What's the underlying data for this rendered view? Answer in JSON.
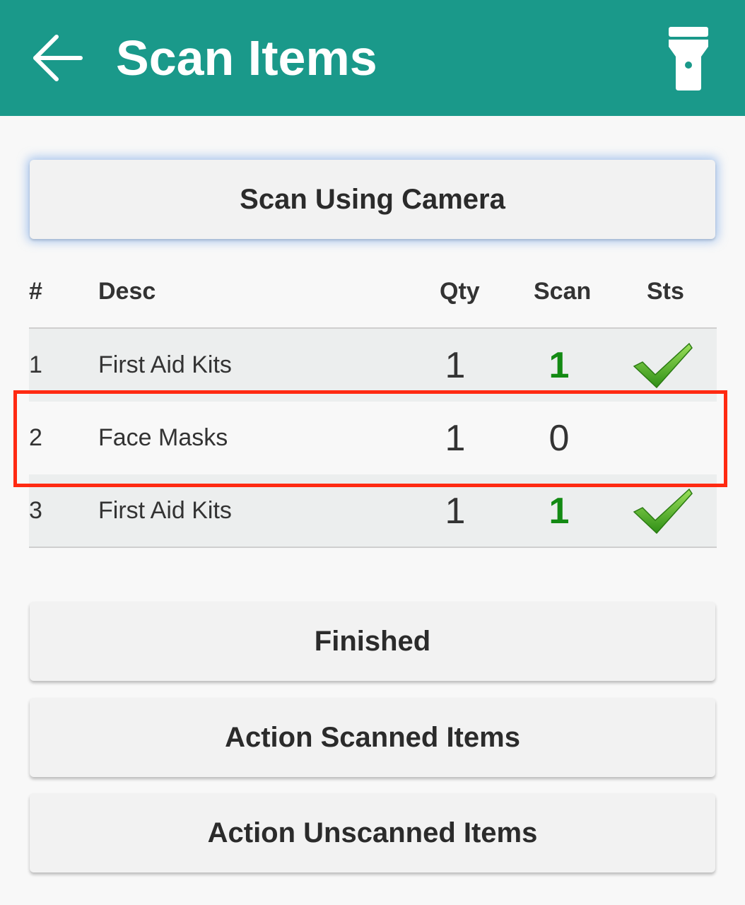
{
  "header": {
    "title": "Scan Items",
    "back_icon": "arrow-left-icon",
    "flashlight_icon": "flashlight-icon",
    "background_color": "#1a998a"
  },
  "scan_button": {
    "label": "Scan Using Camera"
  },
  "table": {
    "columns": [
      "#",
      "Desc",
      "Qty",
      "Scan",
      "Sts"
    ],
    "rows": [
      {
        "num": "1",
        "desc": "First Aid Kits",
        "qty": "1",
        "scan": "1",
        "status": "checkmark-icon"
      },
      {
        "num": "2",
        "desc": "Face Masks",
        "qty": "1",
        "scan": "0",
        "status": ""
      },
      {
        "num": "3",
        "desc": "First Aid Kits",
        "qty": "1",
        "scan": "1",
        "status": "checkmark-icon"
      }
    ],
    "scanned_color": "#138a13",
    "highlight_color": "#ff2a12"
  },
  "actions": {
    "finished": "Finished",
    "action_scanned": "Action Scanned Items",
    "action_unscanned": "Action Unscanned Items"
  }
}
